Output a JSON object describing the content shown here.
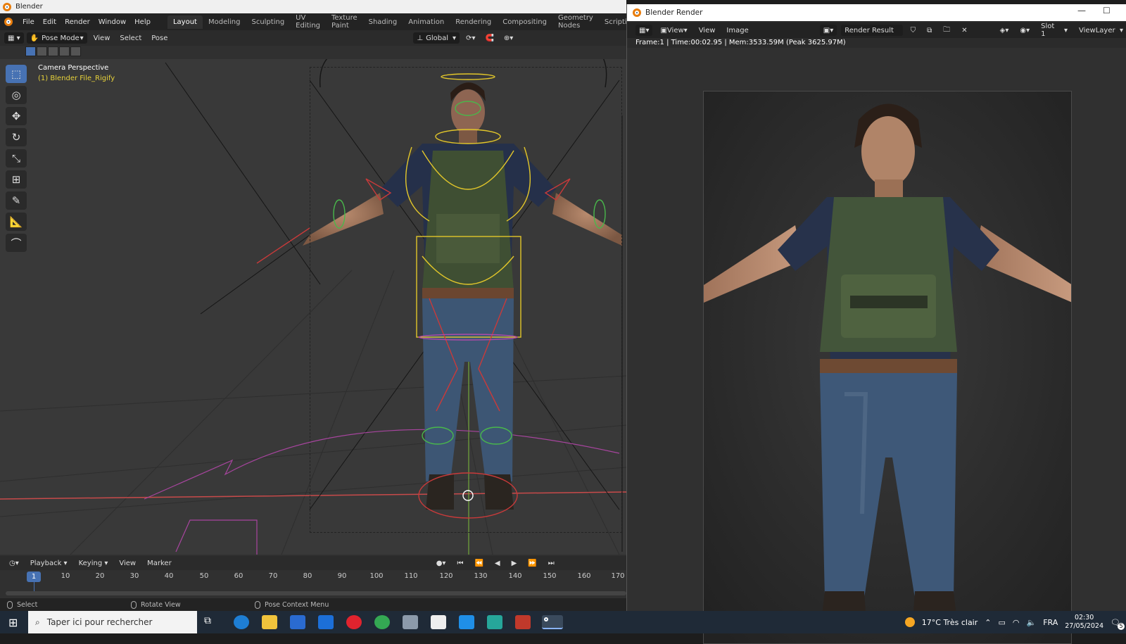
{
  "main_window": {
    "title": "Blender",
    "menu": [
      "File",
      "Edit",
      "Render",
      "Window",
      "Help"
    ],
    "workspaces": [
      "Layout",
      "Modeling",
      "Sculpting",
      "UV Editing",
      "Texture Paint",
      "Shading",
      "Animation",
      "Rendering",
      "Compositing",
      "Geometry Nodes",
      "Scripting"
    ],
    "active_workspace": "Layout",
    "viewport_header": {
      "mode": "Pose Mode",
      "menus": [
        "View",
        "Select",
        "Pose"
      ],
      "orientation": "Global"
    },
    "viewport": {
      "view_name": "Camera Perspective",
      "object_label": "(1) Blender File_Rigify"
    },
    "timeline": {
      "menus": [
        "Playback",
        "Keying",
        "View",
        "Marker"
      ],
      "current_frame": "1",
      "ticks": [
        "10",
        "20",
        "30",
        "40",
        "50",
        "60",
        "70",
        "80",
        "90",
        "100",
        "110",
        "120",
        "130",
        "140",
        "150",
        "160",
        "170"
      ]
    },
    "status_bar": {
      "left": "Select",
      "middle": "Rotate View",
      "right": "Pose Context Menu"
    }
  },
  "render_window": {
    "title": "Blender Render",
    "menus": [
      "View",
      "View",
      "Image"
    ],
    "image_name": "Render Result",
    "slot": "Slot 1",
    "view_layer": "ViewLayer",
    "info": "Frame:1 | Time:00:02.95 | Mem:3533.59M (Peak 3625.97M)"
  },
  "taskbar": {
    "search_placeholder": "Taper ici pour rechercher",
    "weather": "17°C  Très clair",
    "language": "FRA",
    "time": "02:30",
    "date": "27/05/2024",
    "notifications": "5"
  },
  "colors": {
    "blender_orange": "#e87d0d",
    "active_blue": "#4772b3",
    "rig_yellow": "#e2c62a",
    "rig_green": "#49b84b",
    "rig_red": "#c93a3a",
    "rig_magenta": "#b04aa8"
  }
}
